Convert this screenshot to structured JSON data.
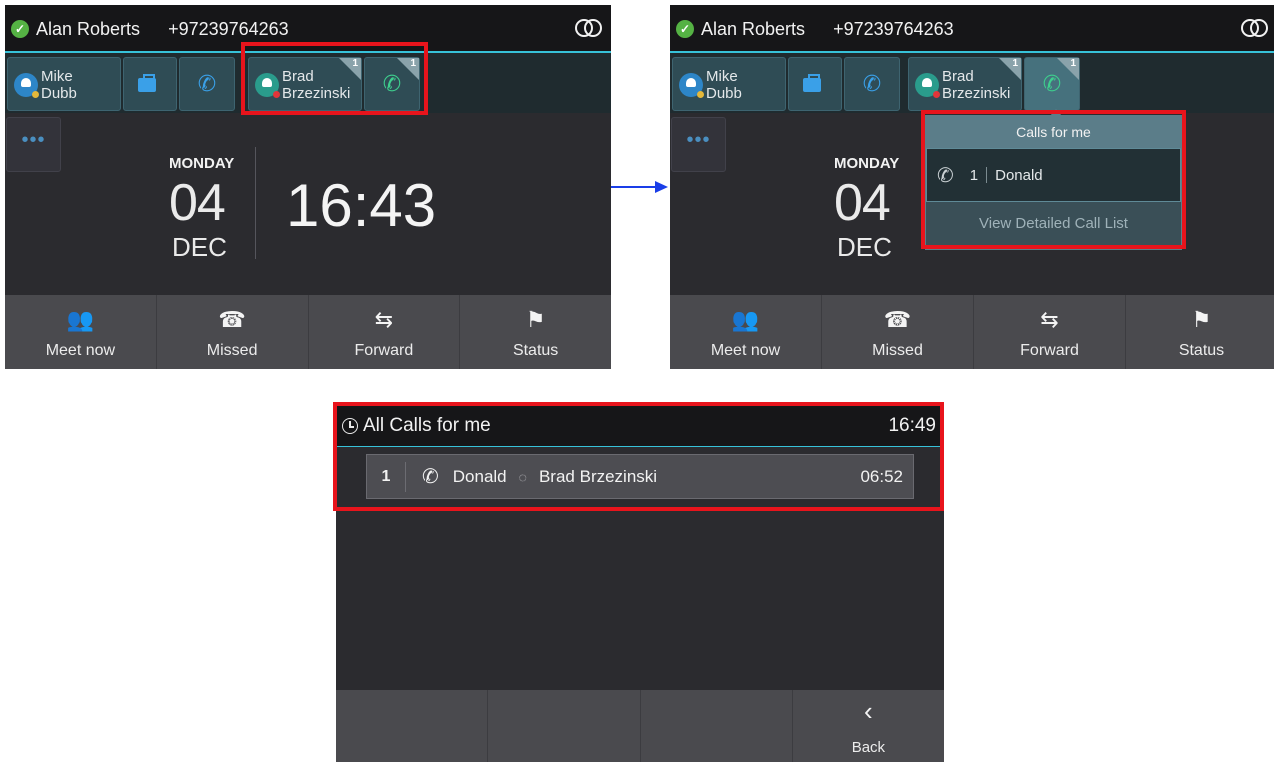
{
  "status_bar": {
    "user_name": "Alan Roberts",
    "phone_number": "+97239764263"
  },
  "contact_strip": {
    "contact_1": {
      "first": "Mike",
      "last": "Dubb"
    },
    "contact_2": {
      "first": "Brad",
      "last": "Brzezinski",
      "badge": "1"
    },
    "call_tile_badge": "1"
  },
  "more_label": "•••",
  "clock": {
    "day": "MONDAY",
    "date": "04",
    "month": "DEC",
    "time": "16:43"
  },
  "softkeys": [
    "Meet now",
    "Missed",
    "Forward",
    "Status"
  ],
  "popup": {
    "title": "Calls for me",
    "call": {
      "index": "1",
      "caller": "Donald"
    },
    "link": "View Detailed Call List"
  },
  "call_list": {
    "title": "All Calls for me",
    "time": "16:49",
    "row": {
      "index": "1",
      "caller": "Donald",
      "agent": "Brad Brzezinski",
      "duration": "06:52"
    },
    "back_label": "Back"
  },
  "colors": {
    "highlight": "#e8141c",
    "arrow": "#1a3ee8",
    "accent": "#37c2d9",
    "presence_ok": "#55b244"
  }
}
